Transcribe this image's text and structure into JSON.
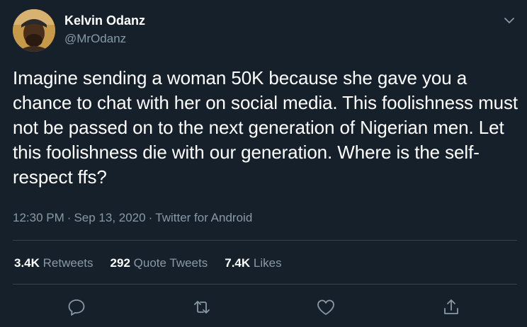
{
  "author": {
    "name": "Kelvin Odanz",
    "handle": "@MrOdanz"
  },
  "tweet": {
    "text": "Imagine sending a woman 50K because she gave you a chance to chat with her on social media. This foolishness must not be passed on to the next generation of Nigerian men. Let this foolishness die with our generation. Where is the self-respect ffs?",
    "time": "12:30 PM",
    "date": "Sep 13, 2020",
    "source": "Twitter for Android",
    "separator": "·"
  },
  "stats": {
    "retweets": {
      "count": "3.4K",
      "label": "Retweets"
    },
    "quotes": {
      "count": "292",
      "label": "Quote Tweets"
    },
    "likes": {
      "count": "7.4K",
      "label": "Likes"
    }
  },
  "icons": {
    "more": "chevron-down-icon",
    "reply": "reply-icon",
    "retweet": "retweet-icon",
    "like": "heart-icon",
    "share": "share-icon"
  },
  "colors": {
    "background": "#15202b",
    "text": "#ffffff",
    "secondary": "#8899a6",
    "divider": "#38444d"
  }
}
